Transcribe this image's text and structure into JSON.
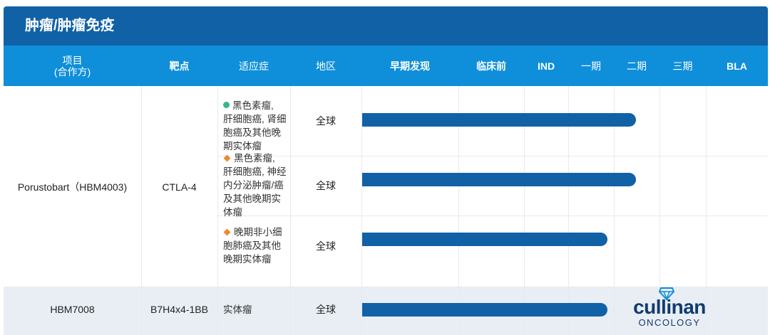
{
  "section": {
    "title": "肿瘤/肿瘤免疫"
  },
  "columns": {
    "project_line1": "项目",
    "project_line2": "(合作方)",
    "target": "靶点",
    "indication": "适应症",
    "region": "地区",
    "stages": [
      "早期发现",
      "临床前",
      "IND",
      "一期",
      "二期",
      "三期",
      "BLA"
    ]
  },
  "rows": [
    {
      "project": "Porustobart（HBM4003)",
      "target": "CTLA-4",
      "indications": [
        {
          "marker": "green-dot",
          "text": "黑色素瘤,\n肝细胞癌, 肾细\n胞癌及其他晚\n期实体瘤",
          "region": "全球",
          "progress_stage": "二期"
        },
        {
          "marker": "orange-diamond",
          "text": "黑色素瘤,\n肝细胞癌, 神经\n内分泌肿瘤/癌\n及其他晚期实\n体瘤",
          "region": "全球",
          "progress_stage": "二期"
        },
        {
          "marker": "orange-diamond",
          "text": "晚期非小细\n胞肺癌及其他\n晚期实体瘤",
          "region": "全球",
          "progress_stage": "一期"
        }
      ]
    },
    {
      "project": "HBM7008",
      "target": "B7H4x4-1BB",
      "indications": [
        {
          "marker": "none",
          "text": "实体瘤",
          "region": "全球",
          "progress_stage": "一期"
        }
      ],
      "partner_logo": {
        "name": "cullinan",
        "sub": "ONCOLOGY"
      }
    }
  ],
  "colors": {
    "header_dark_blue": "#1161a7",
    "header_light_blue": "#0f8fd9",
    "bar": "#1161a7",
    "green_marker": "#34b88a",
    "orange_marker": "#ee8a2a",
    "alt_row": "#e8eef4",
    "logo_navy": "#113b6e"
  },
  "icons": {
    "green_marker": "green-dot-icon",
    "orange_marker": "orange-diamond-icon",
    "logo_gem": "diamond-gem-icon"
  }
}
